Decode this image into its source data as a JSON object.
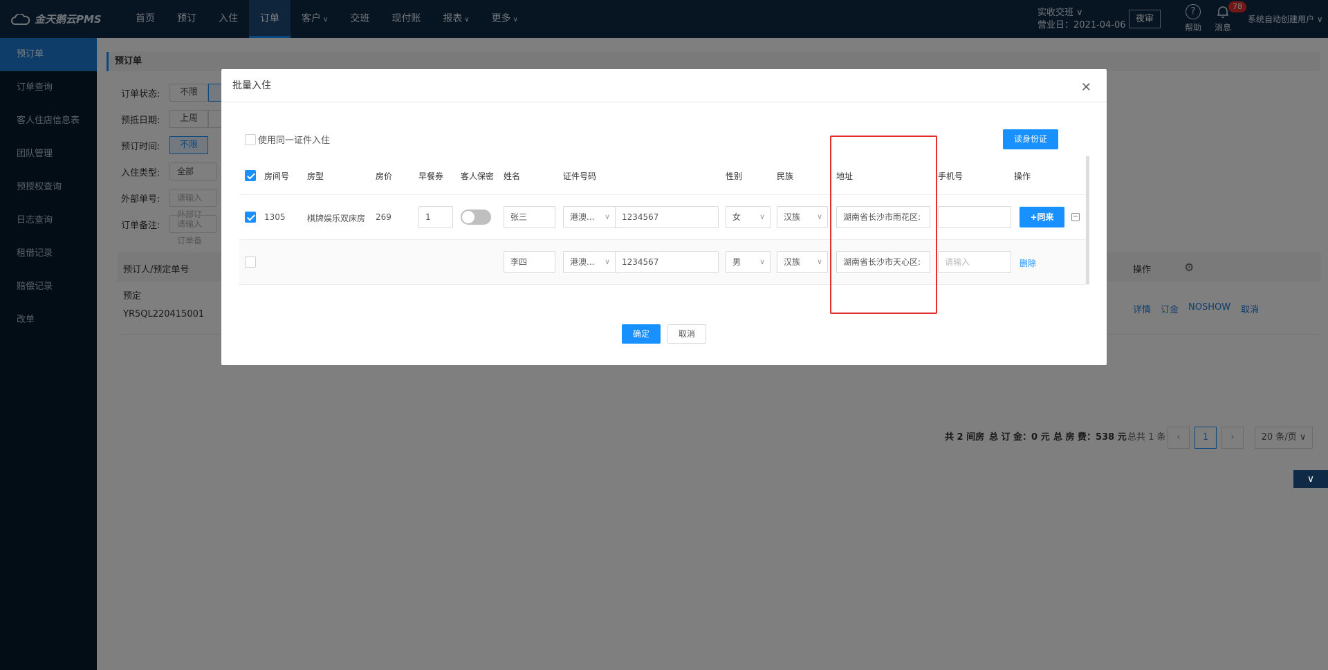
{
  "app": {
    "logo_text": "金天鹅云PMS"
  },
  "nav": [
    {
      "label": "首页",
      "chev": ""
    },
    {
      "label": "预订",
      "chev": ""
    },
    {
      "label": "入住",
      "chev": ""
    },
    {
      "label": "订单",
      "chev": ""
    },
    {
      "label": "客户",
      "chev": "∨"
    },
    {
      "label": "交班",
      "chev": ""
    },
    {
      "label": "现付账",
      "chev": ""
    },
    {
      "label": "报表",
      "chev": "∨"
    },
    {
      "label": "更多",
      "chev": "∨"
    }
  ],
  "header": {
    "shift": "实收交班 ∨",
    "business_day": "营业日：2021-04-06",
    "night_audit": "夜审",
    "help": "帮助",
    "messages": "消息",
    "message_count": "78",
    "user": "系统自动创建用户 ∨"
  },
  "sidebar": {
    "items": [
      "预订单",
      "订单查询",
      "客人住店信息表",
      "团队管理",
      "预授权查询",
      "日志查询",
      "租借记录",
      "赔偿记录",
      "改单"
    ]
  },
  "page": {
    "title": "预订单",
    "filters": {
      "order_status": "订单状态:",
      "status_any": "不限",
      "arrival_date": "预抵日期:",
      "last_week": "上周",
      "booking_time": "预订时间:",
      "time_any": "不限",
      "checkin_type": "入住类型:",
      "type_all": "全部",
      "external_no": "外部单号:",
      "external_placeholder": "请输入外部订",
      "order_note": "订单备注:",
      "note_placeholder": "请输入订单备"
    },
    "table": {
      "booker_col": "预订人/预定单号",
      "actions_col": "操作",
      "row_status": "预定",
      "row_order_no": "YR5QL220415001",
      "actions": {
        "detail": "详情",
        "deposit": "订金",
        "noshow": "NOSHOW",
        "cancel": "取消"
      }
    },
    "footer": {
      "rooms": "共 2 间房",
      "deposit": "总 订 金：0 元",
      "room_fee": "总 房 费：538 元",
      "total": "总共 1 条",
      "current_page": "1",
      "page_size": "20 条/页"
    }
  },
  "modal": {
    "title": "批量入住",
    "same_id": "使用同一证件入住",
    "read_id": "读身份证",
    "columns": {
      "room_no": "房间号",
      "room_type": "房型",
      "price": "房价",
      "breakfast": "早餐券",
      "privacy": "客人保密",
      "name": "姓名",
      "id_no": "证件号码",
      "gender": "性别",
      "ethnicity": "民族",
      "address": "地址",
      "phone": "手机号",
      "ops": "操作"
    },
    "rows": [
      {
        "room_no": "1305",
        "room_type": "棋牌娱乐双床房",
        "price": "269",
        "breakfast": "1",
        "name": "张三",
        "id_type": "港澳...",
        "id_no": "1234567",
        "gender": "女",
        "ethnicity": "汉族",
        "address": "湖南省长沙市雨花区:",
        "phone": "",
        "action": "+同来"
      },
      {
        "name": "李四",
        "id_type": "港澳...",
        "id_no": "1234567",
        "gender": "男",
        "ethnicity": "汉族",
        "address": "湖南省长沙市天心区:",
        "phone_placeholder": "请输入",
        "action": "删除"
      }
    ],
    "ok": "确定",
    "cancel": "取消"
  },
  "colors": {
    "primary": "#1890ff",
    "topbar": "#0f2a46",
    "sidebar": "#071a2d",
    "highlight": "#e3302e"
  }
}
